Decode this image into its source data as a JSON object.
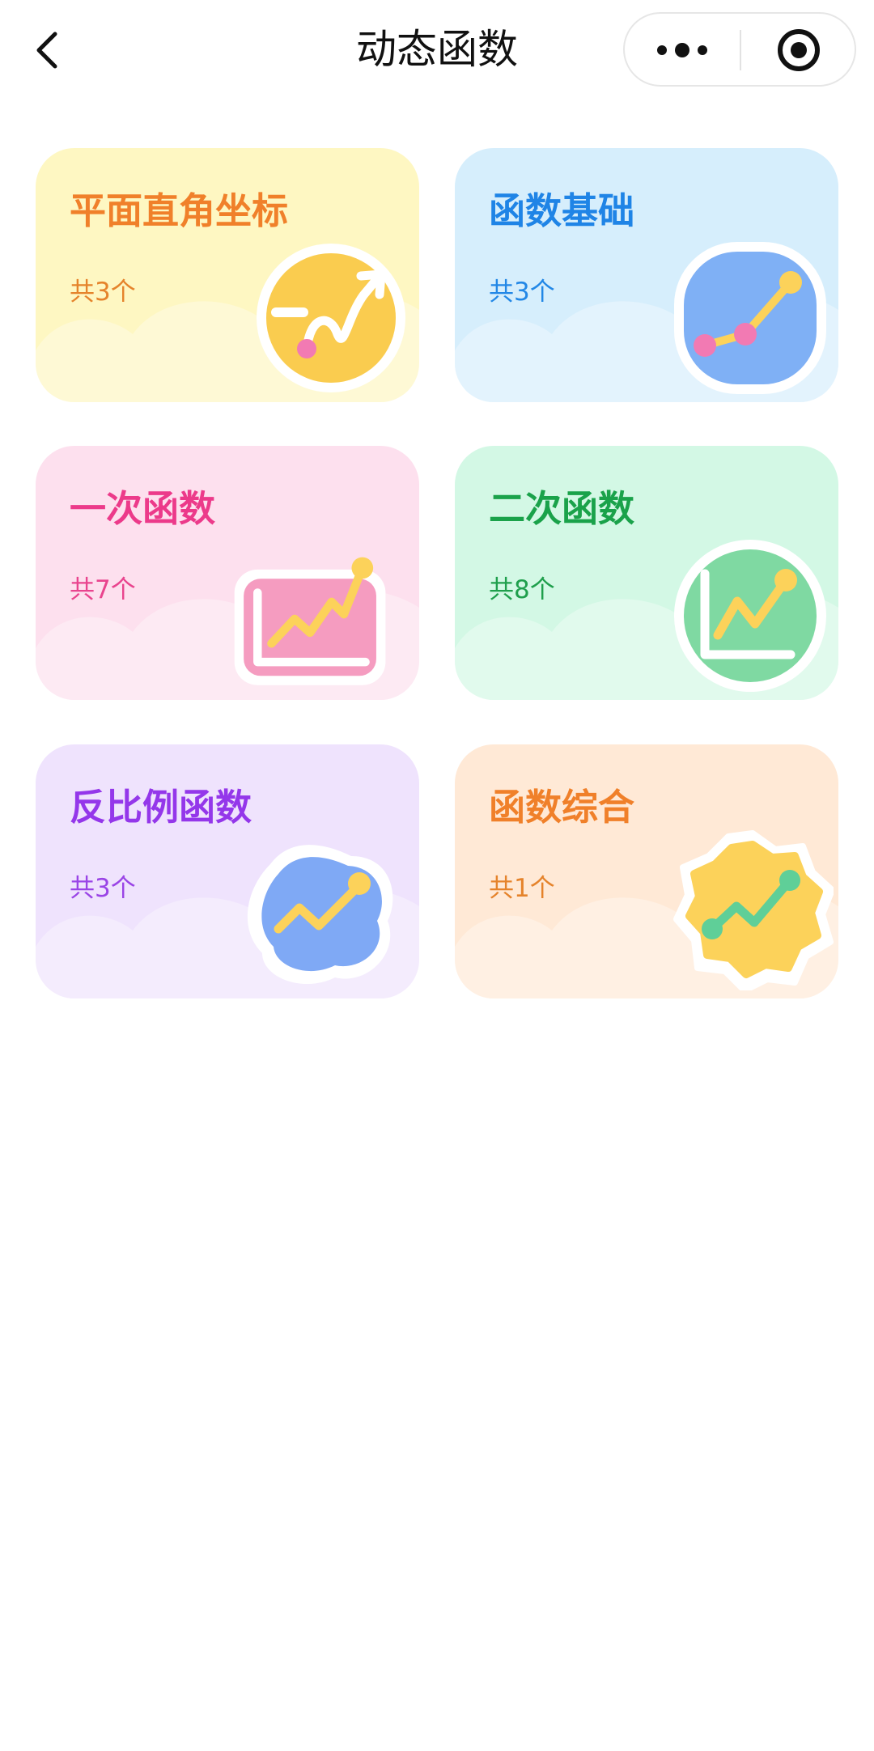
{
  "header": {
    "title": "动态函数"
  },
  "capsule": {
    "more_icon": "more-dots-icon",
    "close_icon": "target-circle-icon"
  },
  "categories": [
    {
      "title": "平面直角坐标",
      "count": "共3个",
      "title_color": "#f0802a",
      "count_color": "#e5832b",
      "bg": "#fef7c2",
      "icon": "curve-arrow-icon"
    },
    {
      "title": "函数基础",
      "count": "共3个",
      "title_color": "#1f84e6",
      "count_color": "#2287e6",
      "bg": "#d6eefc",
      "icon": "line-segment-icon"
    },
    {
      "title": "一次函数",
      "count": "共7个",
      "title_color": "#ec3a8a",
      "count_color": "#e9448e",
      "bg": "#fde0ee",
      "icon": "chart-rising-icon"
    },
    {
      "title": "二次函数",
      "count": "共8个",
      "title_color": "#1aa24a",
      "count_color": "#1f9f4c",
      "bg": "#d3f8e5",
      "icon": "chart-zigzag-icon"
    },
    {
      "title": "反比例函数",
      "count": "共3个",
      "title_color": "#9437ea",
      "count_color": "#9a44e6",
      "bg": "#efe3fd",
      "icon": "trend-blob-icon"
    },
    {
      "title": "函数综合",
      "count": "共1个",
      "title_color": "#f0802a",
      "count_color": "#e5832b",
      "bg": "#ffe9d6",
      "icon": "trend-badge-icon"
    }
  ]
}
